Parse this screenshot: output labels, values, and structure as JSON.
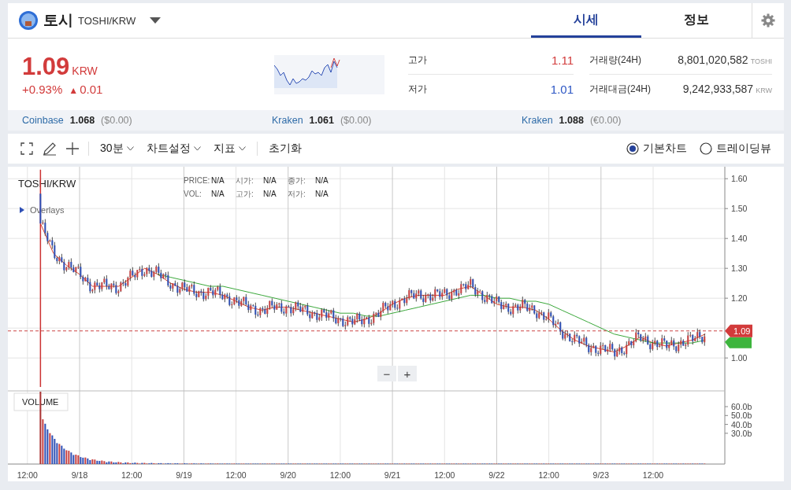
{
  "header": {
    "coin_name": "토시",
    "pair": "TOSHI/KRW"
  },
  "tabs": [
    {
      "label": "시세",
      "selected": true
    },
    {
      "label": "정보",
      "selected": false
    }
  ],
  "price": {
    "value": "1.09",
    "unit": "KRW",
    "change_pct": "+0.93%",
    "change_arrow": "▲",
    "change_abs": "0.01"
  },
  "stats_left": [
    {
      "label": "고가",
      "value": "1.11",
      "color": "#d23b3b"
    },
    {
      "label": "저가",
      "value": "1.01",
      "color": "#2c56c4"
    }
  ],
  "stats_right": [
    {
      "label": "거래량(24H)",
      "value": "8,801,020,582",
      "unit": "TOSHI"
    },
    {
      "label": "거래대금(24H)",
      "value": "9,242,933,587",
      "unit": "KRW"
    }
  ],
  "exchanges": [
    {
      "name": "Coinbase",
      "price": "1.068",
      "diff": "($0.00)"
    },
    {
      "name": "Kraken",
      "price": "1.061",
      "diff": "($0.00)"
    },
    {
      "name": "Kraken",
      "price": "1.088",
      "diff": "(€0.00)"
    }
  ],
  "toolbar": {
    "interval": "30분",
    "menus": [
      "차트설정",
      "지표"
    ],
    "reset": "초기화",
    "views": [
      {
        "label": "기본차트",
        "selected": true
      },
      {
        "label": "트레이딩뷰",
        "selected": false
      }
    ]
  },
  "chart": {
    "symbol": "TOSHI/KRW",
    "overlays": "Overlays",
    "overlays_expanded": false,
    "legend": [
      [
        {
          "label": "PRICE:",
          "value": "N/A"
        },
        {
          "label": "시가:",
          "value": "N/A"
        },
        {
          "label": "종가:",
          "value": "N/A"
        }
      ],
      [
        {
          "label": "VOL:",
          "value": "N/A"
        },
        {
          "label": "고가:",
          "value": "N/A"
        },
        {
          "label": "저가:",
          "value": "N/A"
        }
      ]
    ],
    "chart_data": {
      "type": "line",
      "grid": true,
      "ylim": [
        0.645,
        1.64
      ],
      "yticks": [
        {
          "value": 1.6,
          "label": "1.60"
        },
        {
          "value": 1.5,
          "label": "1.50"
        },
        {
          "value": 1.4,
          "label": "1.40"
        },
        {
          "value": 1.3,
          "label": "1.30"
        },
        {
          "value": 1.2,
          "label": "1.20"
        },
        {
          "value": 1.0,
          "label": "1.00"
        }
      ],
      "categories": [
        null,
        "12:00",
        null,
        null,
        null,
        "9/18",
        null,
        null,
        null,
        "12:00",
        null,
        null,
        null,
        "9/19",
        null,
        null,
        null,
        "12:00",
        null,
        null,
        null,
        "9/20",
        null,
        null,
        null,
        "12:00",
        null,
        null,
        null,
        "9/21",
        null,
        null,
        null,
        "12:00",
        null,
        null,
        null,
        "9/22",
        null,
        null,
        null,
        "12:00",
        null,
        null,
        null,
        "9/23",
        null,
        null,
        null,
        "12:00",
        null,
        null,
        null,
        null,
        null
      ],
      "series": [
        {
          "color": "#d9452f",
          "values": [
            null,
            null,
            1.45,
            1.35,
            1.31,
            1.28,
            1.24,
            1.24,
            1.24,
            1.27,
            1.3,
            1.28,
            1.25,
            1.23,
            1.22,
            1.22,
            1.21,
            1.19,
            1.17,
            1.16,
            1.17,
            1.17,
            1.16,
            1.15,
            1.14,
            1.13,
            1.12,
            1.13,
            1.15,
            1.18,
            1.2,
            1.21,
            1.21,
            1.21,
            1.23,
            1.24,
            1.21,
            1.18,
            1.17,
            1.17,
            1.16,
            1.13,
            1.09,
            1.06,
            1.04,
            1.03,
            1.02,
            1.04,
            1.07,
            1.05,
            1.04,
            1.05,
            1.06,
            1.08,
            null
          ]
        },
        {
          "color": "#3aa83a",
          "values": [
            null,
            null,
            null,
            null,
            null,
            null,
            null,
            null,
            null,
            null,
            null,
            1.28,
            1.27,
            1.26,
            1.25,
            1.24,
            1.24,
            1.23,
            1.22,
            1.21,
            1.2,
            1.19,
            1.18,
            1.17,
            1.16,
            1.15,
            1.15,
            1.14,
            1.14,
            1.15,
            1.16,
            1.17,
            1.18,
            1.19,
            1.2,
            1.21,
            1.21,
            1.2,
            1.2,
            1.19,
            1.19,
            1.18,
            1.16,
            1.14,
            1.12,
            1.1,
            1.08,
            1.07,
            1.06,
            1.05,
            1.05,
            1.05,
            1.05,
            1.06,
            null
          ]
        }
      ]
    },
    "volume_axis": [
      "60.0b",
      "50.0b",
      "40.0b",
      "30.0b"
    ],
    "current_price": "1.09",
    "volume_label": "VOLUME",
    "zoom_out": "−",
    "zoom_in": "+"
  }
}
